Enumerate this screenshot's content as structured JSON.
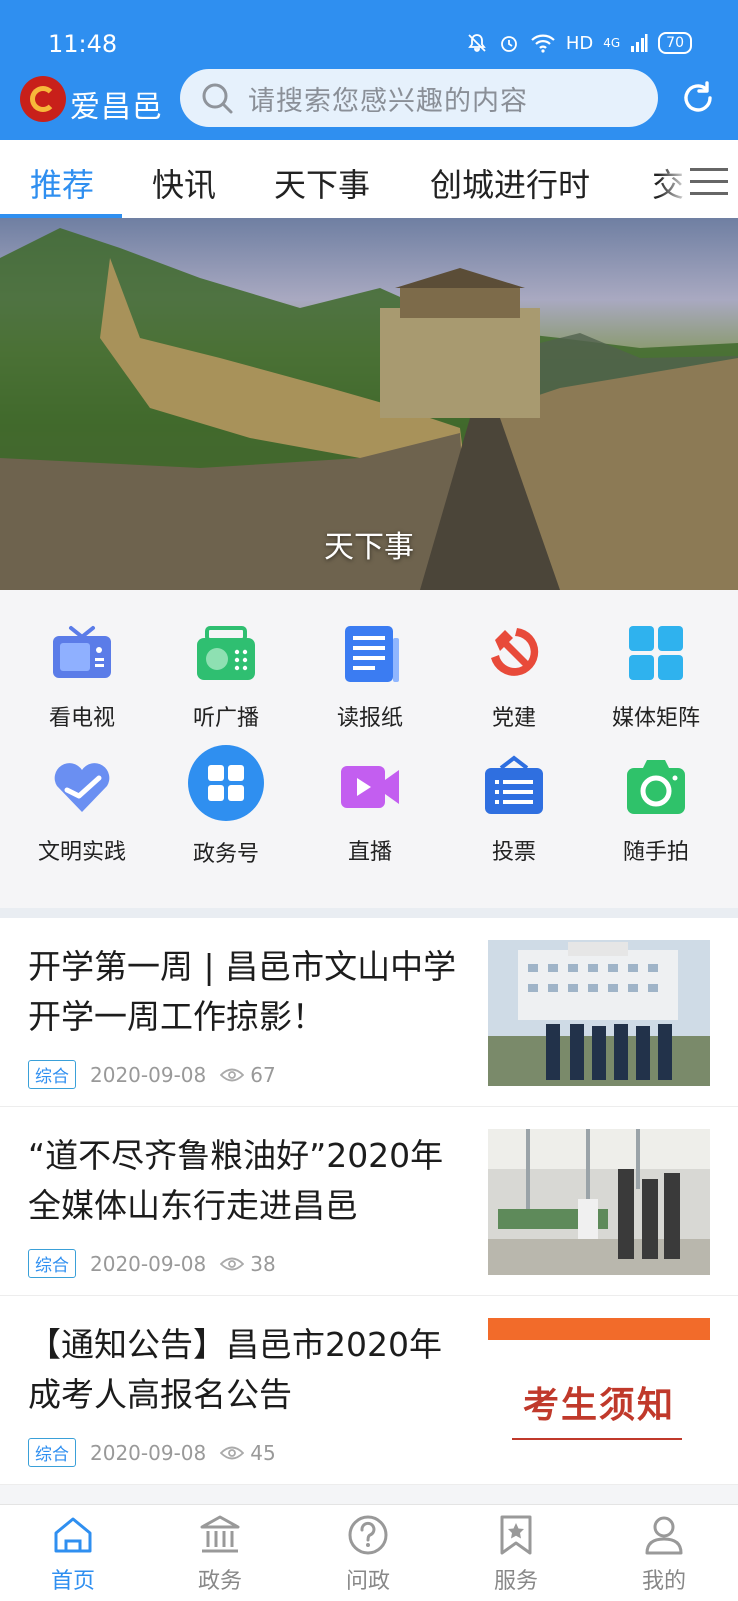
{
  "status_bar": {
    "time": "11:48",
    "network": "HD",
    "signal": "4G",
    "battery": "70"
  },
  "header": {
    "brand": "爱昌邑",
    "search_placeholder": "请搜索您感兴趣的内容"
  },
  "tabs": [
    {
      "label": "推荐",
      "active": true
    },
    {
      "label": "快讯"
    },
    {
      "label": "天下事"
    },
    {
      "label": "创城进行时"
    },
    {
      "label": "交"
    }
  ],
  "banner": {
    "caption": "天下事"
  },
  "features": [
    {
      "label": "看电视",
      "icon": "tv-icon"
    },
    {
      "label": "听广播",
      "icon": "radio-icon"
    },
    {
      "label": "读报纸",
      "icon": "newspaper-icon"
    },
    {
      "label": "党建",
      "icon": "party-emblem-icon"
    },
    {
      "label": "媒体矩阵",
      "icon": "grid-icon"
    },
    {
      "label": "文明实践",
      "icon": "heart-hand-icon"
    },
    {
      "label": "政务号",
      "icon": "apps-icon"
    },
    {
      "label": "直播",
      "icon": "video-icon"
    },
    {
      "label": "投票",
      "icon": "ballot-icon"
    },
    {
      "label": "随手拍",
      "icon": "camera-icon"
    }
  ],
  "news": [
    {
      "title": "开学第一周 | 昌邑市文山中学开学一周工作掠影！",
      "tag": "综合",
      "date": "2020-09-08",
      "views": "67"
    },
    {
      "title": "“道不尽齐鲁粮油好”2020年全媒体山东行走进昌邑",
      "tag": "综合",
      "date": "2020-09-08",
      "views": "38"
    },
    {
      "title": "【通知公告】昌邑市2020年成考人高报名公告",
      "tag": "综合",
      "date": "2020-09-08",
      "views": "45",
      "thumb_text": "考生须知"
    }
  ],
  "bottom_nav": [
    {
      "label": "首页",
      "icon": "home-icon",
      "active": true
    },
    {
      "label": "政务",
      "icon": "government-icon"
    },
    {
      "label": "问政",
      "icon": "question-icon"
    },
    {
      "label": "服务",
      "icon": "bookmark-star-icon"
    },
    {
      "label": "我的",
      "icon": "user-icon"
    }
  ],
  "colors": {
    "primary": "#2f8ff0",
    "tag": "#2f8ff0"
  }
}
